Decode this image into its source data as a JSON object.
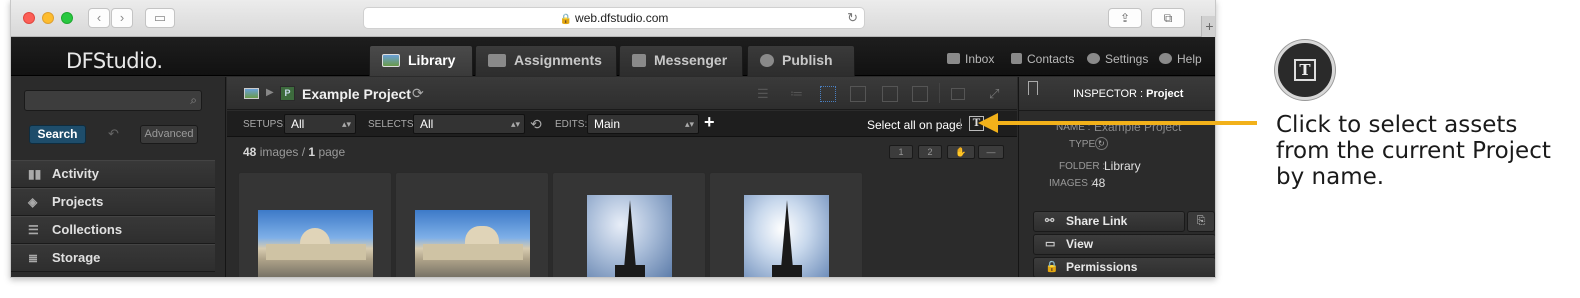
{
  "browser": {
    "url": "web.dfstudio.com"
  },
  "app": {
    "logo": "DFStudio.",
    "tabs": [
      {
        "label": "Library",
        "active": true
      },
      {
        "label": "Assignments",
        "active": false
      },
      {
        "label": "Messenger",
        "active": false
      },
      {
        "label": "Publish",
        "active": false
      }
    ],
    "top_links": [
      "Inbox",
      "Contacts",
      "Settings",
      "Help"
    ]
  },
  "sidebar": {
    "search_label": "Search",
    "advanced_label": "Advanced",
    "items": [
      {
        "label": "Activity",
        "icon": "bar-chart-icon"
      },
      {
        "label": "Projects",
        "icon": "layers-icon"
      },
      {
        "label": "Collections",
        "icon": "database-icon"
      },
      {
        "label": "Storage",
        "icon": "storage-icon"
      }
    ]
  },
  "main": {
    "project_title": "Example Project",
    "filters": {
      "setups_label": "SETUPS:",
      "setups_value": "All",
      "selects_label": "SELECTS:",
      "selects_value": "All",
      "edits_label": "EDITS:",
      "edits_value": "Main"
    },
    "select_all_label": "Select all on page",
    "text_select_button": "T",
    "count": {
      "images_num": "48",
      "images_word": "images /",
      "pages_num": "1",
      "pages_word": "page"
    },
    "pager": [
      "1",
      "2"
    ]
  },
  "inspector": {
    "title_prefix": "INSPECTOR :",
    "title_value": "Project",
    "name_label": "NAME :",
    "name_value": "Example Project",
    "type_label": "TYPE :",
    "folder_label": "FOLDER :",
    "folder_value": "Library",
    "images_label": "IMAGES :",
    "images_value": "48",
    "buttons": [
      "Share Link",
      "View",
      "Permissions"
    ]
  },
  "callout": {
    "icon_glyph": "T",
    "text": "Click to select assets from the current Project by name."
  },
  "colors": {
    "accent_arrow": "#f2b11a",
    "search_button": "#1e4d6b",
    "app_background": "#2b2b2b"
  }
}
